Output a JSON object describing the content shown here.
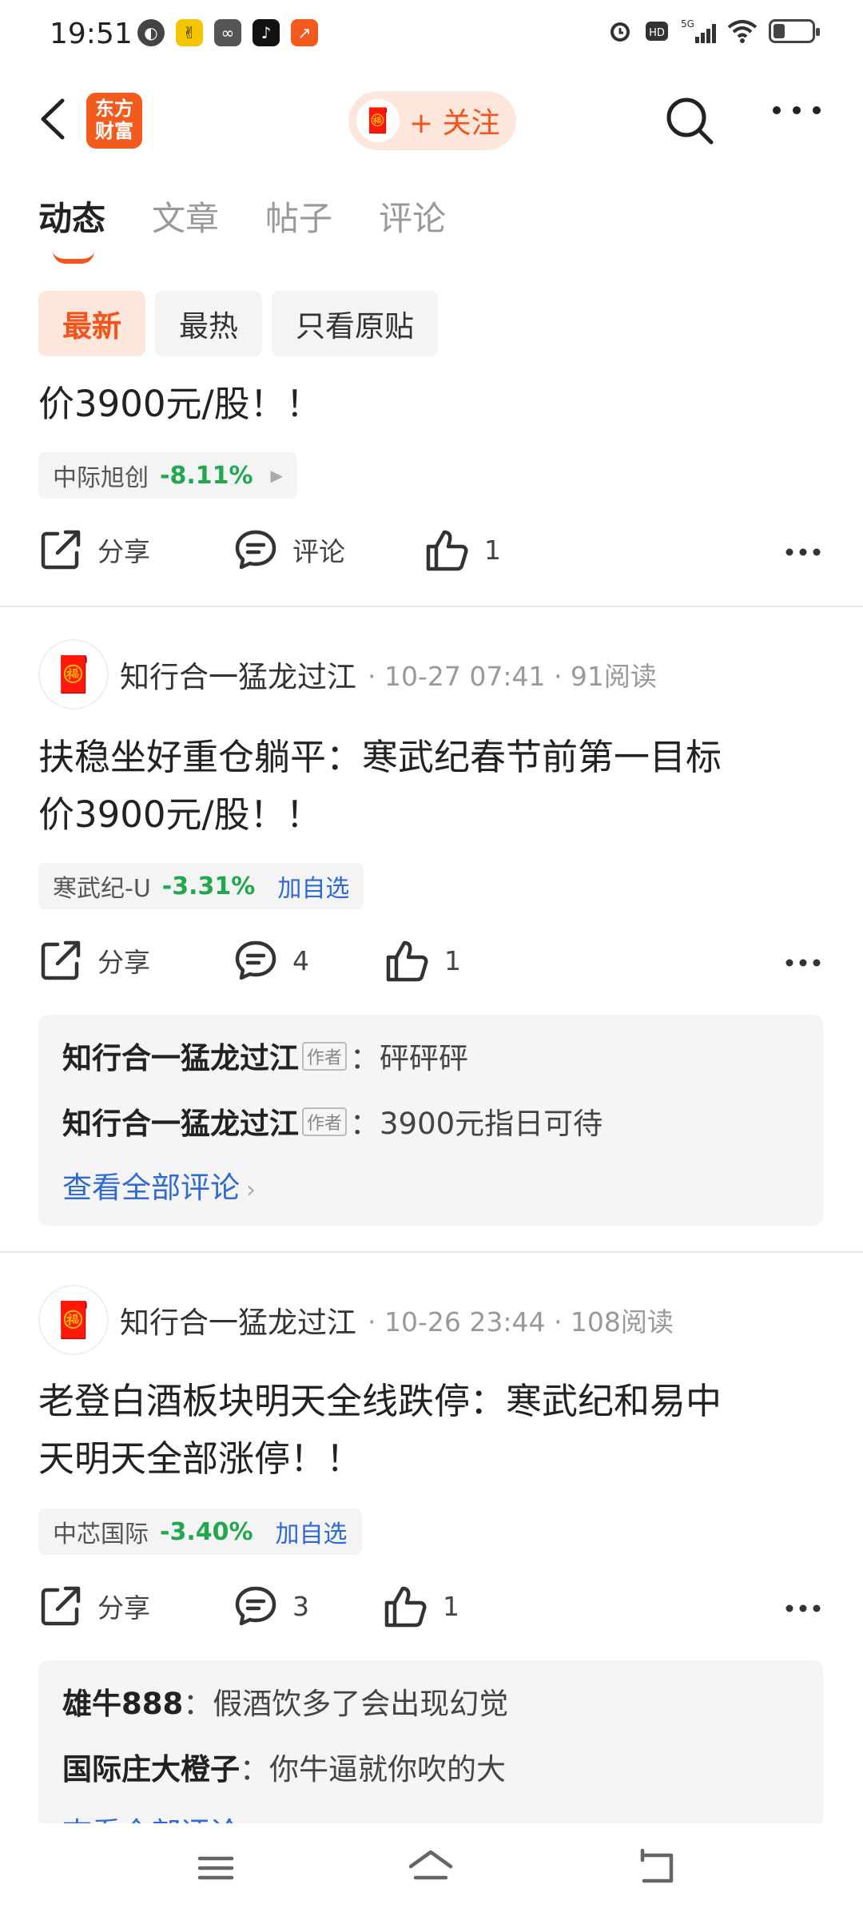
{
  "status_bar": {
    "time": "19:51"
  },
  "header": {
    "logo_text": "东方财富",
    "follow_label": "+ 关注"
  },
  "tabs": [
    {
      "label": "动态"
    },
    {
      "label": "文章"
    },
    {
      "label": "帖子"
    },
    {
      "label": "评论"
    }
  ],
  "filters": [
    {
      "label": "最新"
    },
    {
      "label": "最热"
    },
    {
      "label": "只看原贴"
    }
  ],
  "colors": {
    "accent": "#f2541c",
    "down_green": "#21a84f",
    "link_blue": "#2e6ad1"
  },
  "posts": [
    {
      "title_tail": "价3900元/股！！",
      "stock_name": "中际旭创",
      "stock_change": "-8.11%",
      "share_label": "分享",
      "comment_label": "评论",
      "like_count": "1"
    },
    {
      "author": "知行合一猛龙过江",
      "meta": "· 10-27 07:41 · 91阅读",
      "title_line1": "扶稳坐好重仓躺平：寒武纪春节前第一目标",
      "title_line2": "价3900元/股！！",
      "stock_name": "寒武纪-U",
      "stock_change": "-3.31%",
      "add_label": "加自选",
      "share_label": "分享",
      "comment_count": "4",
      "like_count": "1",
      "comments": [
        {
          "user": "知行合一猛龙过江",
          "tag": "作者",
          "text": "：砰砰砰"
        },
        {
          "user": "知行合一猛龙过江",
          "tag": "作者",
          "text": "：3900元指日可待"
        }
      ],
      "view_all": "查看全部评论"
    },
    {
      "author": "知行合一猛龙过江",
      "meta": "· 10-26 23:44 · 108阅读",
      "title_line1": "老登白酒板块明天全线跌停：寒武纪和易中",
      "title_line2": "天明天全部涨停！！",
      "stock_name": "中芯国际",
      "stock_change": "-3.40%",
      "add_label": "加自选",
      "share_label": "分享",
      "comment_count": "3",
      "like_count": "1",
      "comments": [
        {
          "user": "雄牛888",
          "text": "：假酒饮多了会出现幻觉"
        },
        {
          "user": "国际庄大橙子",
          "text": "：你牛逼就你吹的大"
        }
      ],
      "view_all": "查看全部评论"
    }
  ]
}
